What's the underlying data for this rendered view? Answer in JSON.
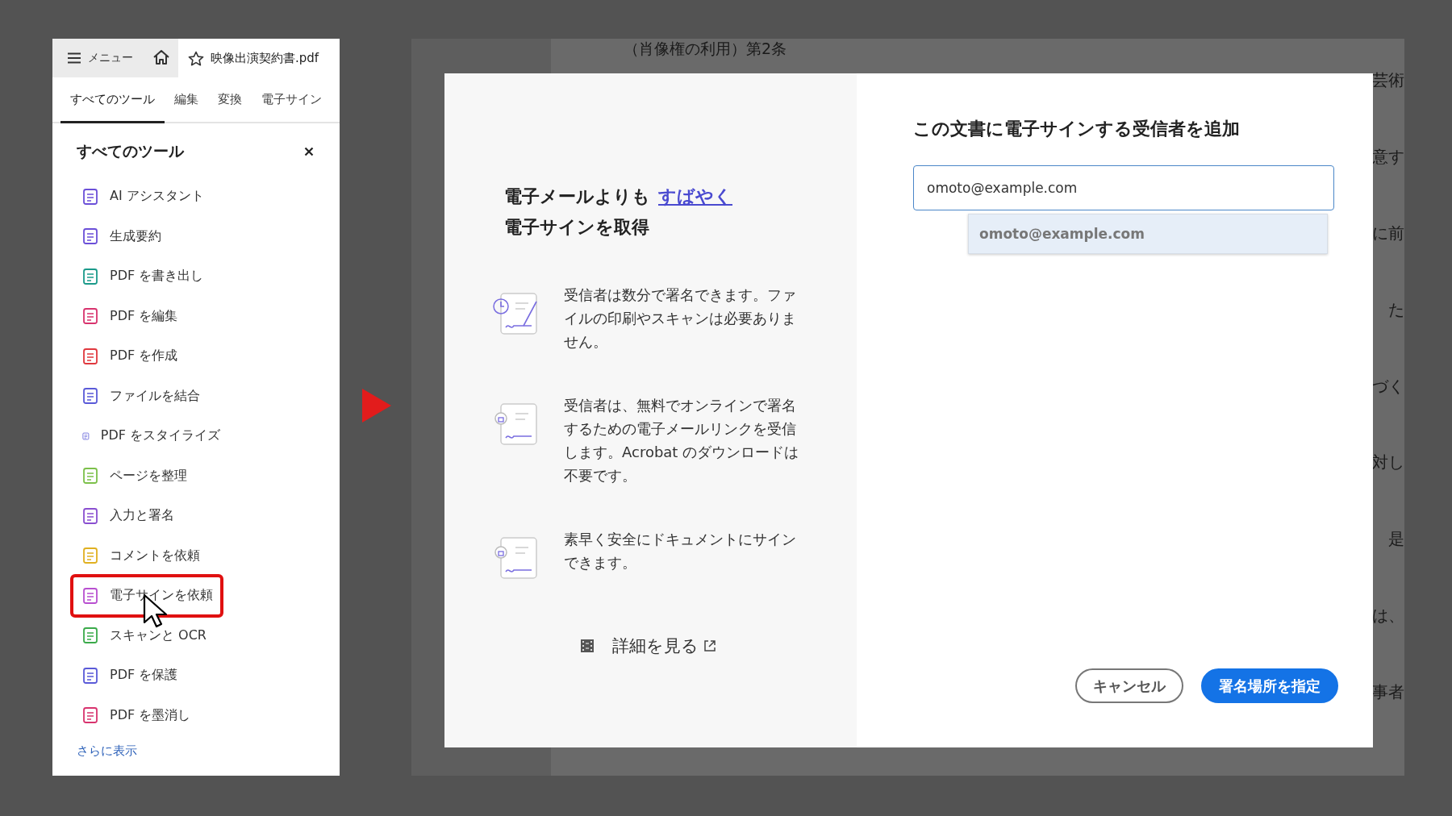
{
  "app_bar": {
    "menu_label": "メニュー",
    "file_tab": {
      "title": "映像出演契約書.pdf"
    }
  },
  "tabs": [
    {
      "label": "すべてのツール",
      "selected": true
    },
    {
      "label": "編集",
      "selected": false
    },
    {
      "label": "変換",
      "selected": false
    },
    {
      "label": "電子サイン",
      "selected": false
    }
  ],
  "tools_panel": {
    "title": "すべてのツール",
    "items": [
      {
        "label": "AI アシスタント",
        "highlighted": false
      },
      {
        "label": "生成要約",
        "highlighted": false
      },
      {
        "label": "PDF を書き出し",
        "highlighted": false
      },
      {
        "label": "PDF を編集",
        "highlighted": false
      },
      {
        "label": "PDF を作成",
        "highlighted": false
      },
      {
        "label": "ファイルを結合",
        "highlighted": false
      },
      {
        "label": "PDF をスタイライズ",
        "highlighted": false
      },
      {
        "label": "ページを整理",
        "highlighted": false
      },
      {
        "label": "入力と署名",
        "highlighted": false
      },
      {
        "label": "コメントを依頼",
        "highlighted": false
      },
      {
        "label": "電子サインを依頼",
        "highlighted": true
      },
      {
        "label": "スキャンと OCR",
        "highlighted": false
      },
      {
        "label": "PDF を保護",
        "highlighted": false
      },
      {
        "label": "PDF を墨消し",
        "highlighted": false
      }
    ],
    "more_link": "さらに表示"
  },
  "document": {
    "heading": "（肖像権の利用）第2条",
    "edge_fragments": [
      "芸術",
      "意す",
      "に前",
      "た",
      "づく",
      "対し",
      "是",
      "は、",
      "事者"
    ]
  },
  "dialog": {
    "promo": {
      "heading": "電子メールよりも",
      "heading_link": "すばやく",
      "heading_line2": "電子サインを取得",
      "features": [
        "受信者は数分で署名できます。ファイルの印刷やスキャンは必要ありません。",
        "受信者は、無料でオンラインで署名するための電子メールリンクを受信します。Acrobat のダウンロードは不要です。",
        "素早く安全にドキュメントにサインできます。"
      ],
      "details_link": "詳細を見る"
    },
    "title": "この文書に電子サインする受信者を追加",
    "recipient_field": {
      "value": "omoto@example.com"
    },
    "suggestions": [
      "omoto@example.com"
    ],
    "buttons": [
      {
        "label": "キャンセル",
        "kind": "secondary"
      },
      {
        "label": "署名場所を指定",
        "kind": "primary"
      }
    ]
  }
}
